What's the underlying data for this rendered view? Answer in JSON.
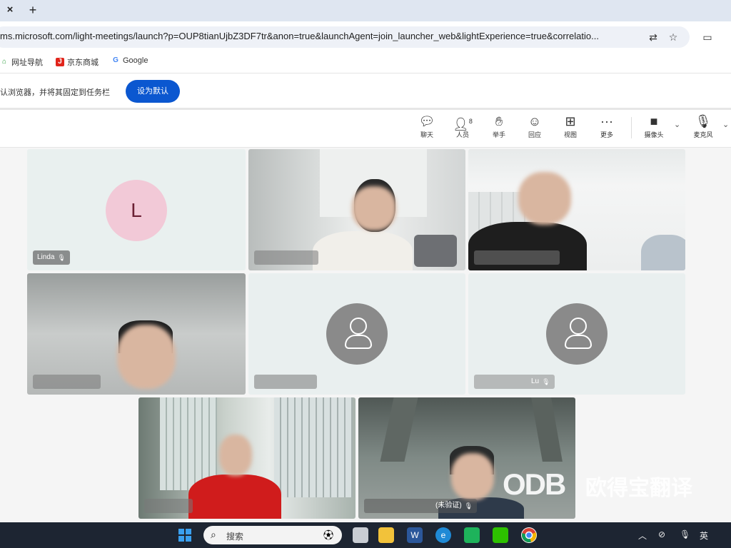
{
  "browser": {
    "tab_close": "×",
    "tab_new": "+",
    "url": "ms.microsoft.com/light-meetings/launch?p=OUP8tianUjbZ3DF7tr&anon=true&launchAgent=join_launcher_web&lightExperience=true&correlatio...",
    "bookmarks": [
      {
        "label": "网址导航",
        "icon": "home-icon",
        "color": "#2a9d3a"
      },
      {
        "label": "京东商城",
        "icon": "jd-icon",
        "color": "#e1251b"
      },
      {
        "label": "Google",
        "icon": "google-icon",
        "color": "#4285f4"
      }
    ],
    "infobar_text": "认浏览器，并将其固定到任务栏",
    "set_default_label": "设为默认"
  },
  "toolbar": {
    "items": [
      {
        "label": "聊天",
        "icon": "chat-icon"
      },
      {
        "label": "人员",
        "icon": "people-icon",
        "badge": "8"
      },
      {
        "label": "举手",
        "icon": "raise-hand-icon"
      },
      {
        "label": "回应",
        "icon": "react-icon"
      },
      {
        "label": "视图",
        "icon": "view-icon"
      },
      {
        "label": "更多",
        "icon": "more-icon"
      },
      {
        "label": "摄像头",
        "icon": "camera-off-icon"
      },
      {
        "label": "麦克风",
        "icon": "mic-icon"
      }
    ]
  },
  "participants": [
    {
      "name": "Linda",
      "avatar_letter": "L",
      "type": "initial"
    },
    {
      "name": "",
      "type": "video"
    },
    {
      "name": "",
      "type": "video"
    },
    {
      "name": "",
      "type": "video"
    },
    {
      "name": "",
      "type": "placeholder"
    },
    {
      "name": "Lu",
      "type": "placeholder"
    },
    {
      "name": "",
      "type": "video"
    },
    {
      "name": "(未验证)",
      "type": "video"
    }
  ],
  "watermark": {
    "logo": "ODB",
    "text": "欧得宝翻译"
  },
  "taskbar": {
    "search_placeholder": "搜索",
    "tray_lang": "英"
  }
}
